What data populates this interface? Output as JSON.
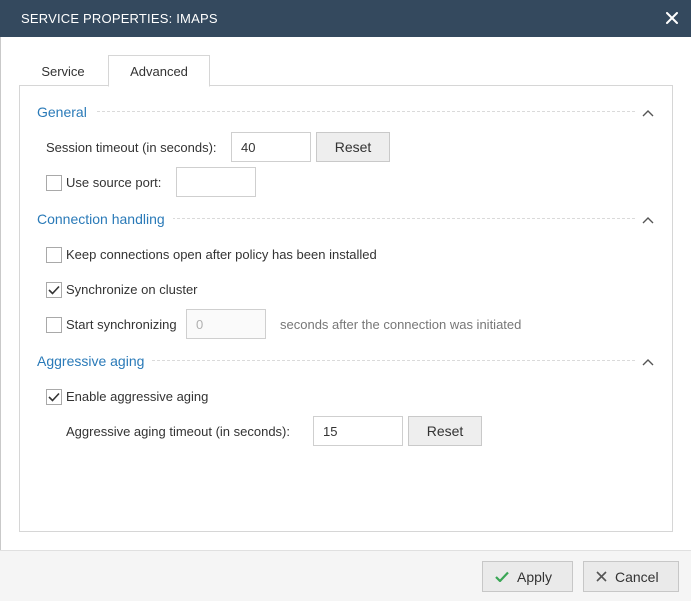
{
  "dialog": {
    "title": "SERVICE PROPERTIES: IMAPS",
    "close_icon": "close-icon"
  },
  "tabs": [
    {
      "label": "Service",
      "active": false
    },
    {
      "label": "Advanced",
      "active": true
    }
  ],
  "general": {
    "title": "General",
    "session_timeout_label": "Session timeout (in seconds):",
    "session_timeout_value": "40",
    "reset_label": "Reset",
    "use_source_port_label": "Use source port:",
    "use_source_port_checked": false,
    "source_port_value": ""
  },
  "connection_handling": {
    "title": "Connection handling",
    "keep_open_label": "Keep connections open after policy has been installed",
    "keep_open_checked": false,
    "sync_cluster_label": "Synchronize on cluster",
    "sync_cluster_checked": true,
    "start_sync_label": "Start synchronizing",
    "start_sync_checked": false,
    "start_sync_value": "0",
    "start_sync_suffix": "seconds after the connection was initiated"
  },
  "aggressive_aging": {
    "title": "Aggressive aging",
    "enable_label": "Enable aggressive aging",
    "enable_checked": true,
    "timeout_label": "Aggressive aging timeout (in seconds):",
    "timeout_value": "15",
    "reset_label": "Reset"
  },
  "footer": {
    "apply_label": "Apply",
    "cancel_label": "Cancel"
  },
  "colors": {
    "titlebar": "#34495e",
    "section_title": "#2a7ab8",
    "apply_check": "#3aa655"
  }
}
